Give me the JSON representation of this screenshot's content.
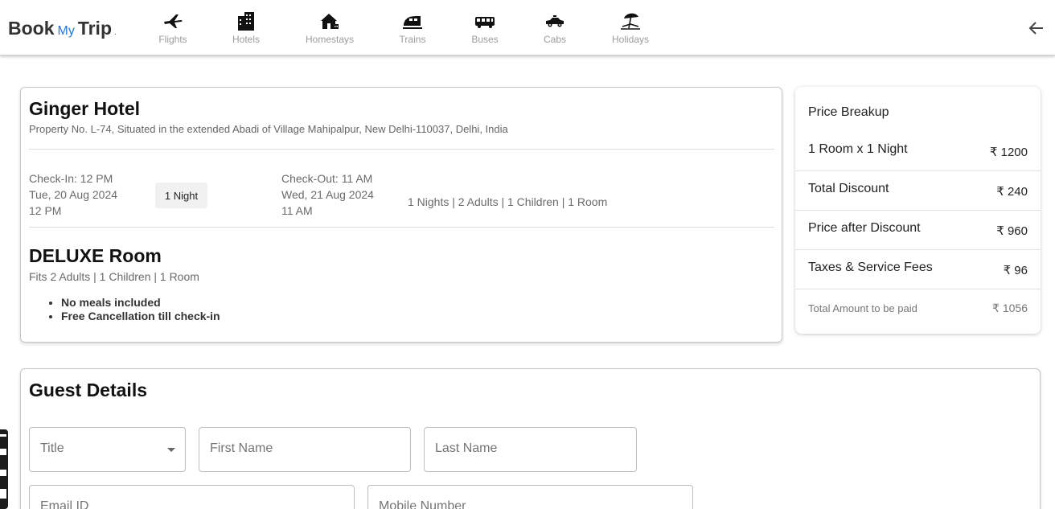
{
  "header": {
    "logo": {
      "book": "Book",
      "my": "My",
      "trip": "Trip",
      "dot": "."
    },
    "nav": [
      {
        "label": "Flights",
        "icon": "plane-icon"
      },
      {
        "label": "Hotels",
        "icon": "building-icon"
      },
      {
        "label": "Homestays",
        "icon": "house-icon"
      },
      {
        "label": "Trains",
        "icon": "train-icon"
      },
      {
        "label": "Buses",
        "icon": "bus-icon"
      },
      {
        "label": "Cabs",
        "icon": "car-icon"
      },
      {
        "label": "Holidays",
        "icon": "beach-umbrella-icon"
      }
    ],
    "back_icon": "arrow-left-icon"
  },
  "hotel": {
    "name": "Ginger Hotel",
    "address": "Property No. L-74, Situated in the extended Abadi of Village Mahipalpur, New Delhi-110037, Delhi, India",
    "check_in": {
      "label": "Check-In: 12 PM",
      "date": "Tue, 20 Aug 2024",
      "time": "12 PM"
    },
    "nights_badge": "1 Night",
    "check_out": {
      "label": "Check-Out: 11 AM",
      "date": "Wed, 21 Aug 2024",
      "time": "11 AM"
    },
    "stay_summary": "1 Nights | 2 Adults | 1 Children | 1 Room",
    "room": {
      "name": "DELUXE Room",
      "fits": "Fits 2 Adults | 1 Children | 1 Room",
      "perks": [
        "No meals included",
        "Free Cancellation till check-in"
      ]
    }
  },
  "price": {
    "title": "Price Breakup",
    "rows": [
      {
        "label": "1 Room x 1 Night",
        "value": "₹ 1200"
      },
      {
        "label": "Total Discount",
        "value": "₹ 240"
      },
      {
        "label": "Price after Discount",
        "value": "₹ 960"
      },
      {
        "label": "Taxes & Service Fees",
        "value": "₹ 96"
      }
    ],
    "total": {
      "label": "Total Amount to be paid",
      "value": "₹ 1056"
    }
  },
  "guest": {
    "title": "Guest Details",
    "fields": {
      "title": "Title",
      "first_name": "First Name",
      "last_name": "Last Name",
      "email": "Email ID",
      "mobile": "Mobile Number"
    }
  },
  "colors": {
    "accent": "#2277dd",
    "muted_text": "#9b9b9b"
  }
}
